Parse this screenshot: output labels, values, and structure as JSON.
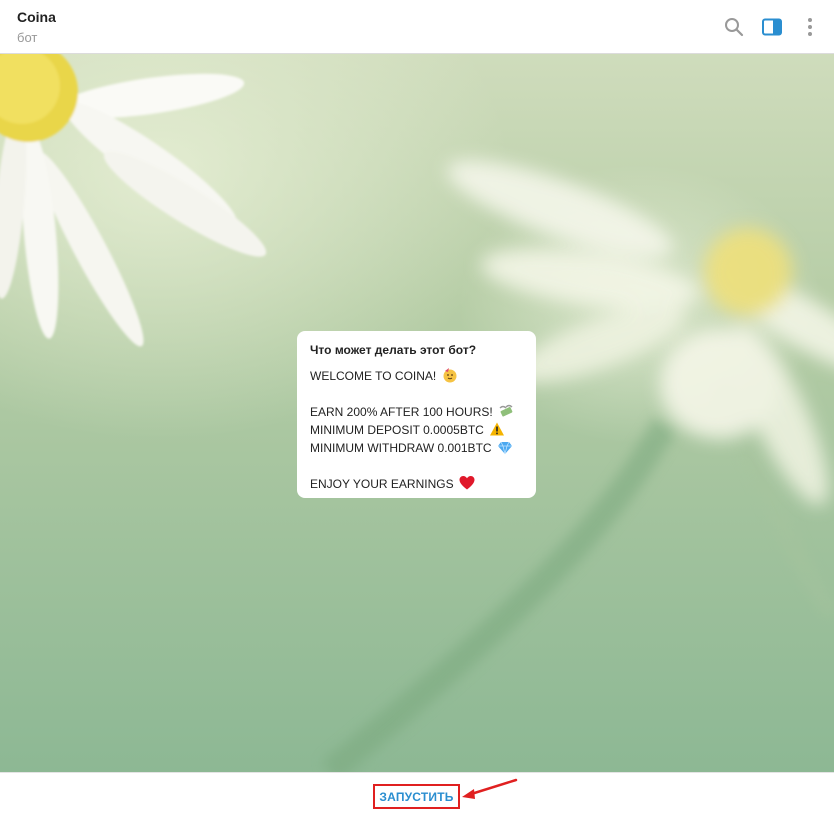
{
  "header": {
    "title": "Coina",
    "subtitle": "бот",
    "icons": [
      "search-icon",
      "side-panel-icon",
      "more-vertical-icon"
    ],
    "accent_color": "#2a8ed0"
  },
  "bot_info": {
    "title": "Что может делать этот бот?",
    "lines": [
      "WELCOME TO COINA!",
      "EARN 200% AFTER 100 HOURS!",
      "MINIMUM DEPOSIT 0.0005BTC",
      "MINIMUM WITHDRAW 0.001BTC",
      "ENJOY YOUR EARNINGS"
    ],
    "emojis": [
      "partying-face-emoji",
      "money-with-wings-emoji",
      "warning-emoji",
      "gem-emoji",
      "red-heart-emoji"
    ]
  },
  "bottom": {
    "start_label": "ЗАПУСТИТЬ",
    "highlight_color": "#e02020"
  }
}
